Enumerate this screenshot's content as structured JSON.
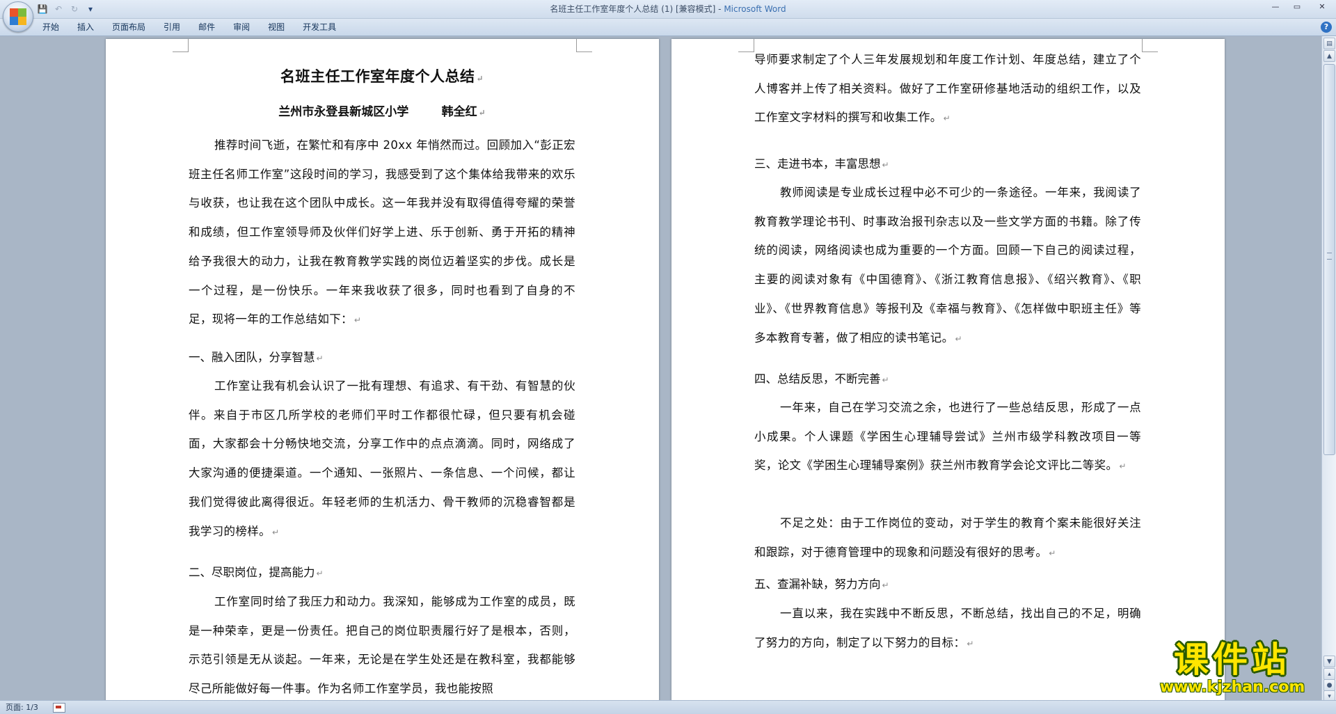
{
  "window": {
    "title": "名班主任工作室年度个人总结 (1) [兼容模式] - ",
    "app_name": "Microsoft Word",
    "minimize": "—",
    "maximize": "▭",
    "close": "✕"
  },
  "quick_access": {
    "save_icon": "💾",
    "undo_icon": "↶",
    "redo_icon": "↻",
    "customize_icon": "▾"
  },
  "ribbon": {
    "tabs": [
      "开始",
      "插入",
      "页面布局",
      "引用",
      "邮件",
      "审阅",
      "视图",
      "开发工具"
    ],
    "help": "?"
  },
  "left_page": {
    "title": "名班主任工作室年度个人总结",
    "author": "兰州市永登县新城区小学        韩全红",
    "p1": "推荐时间飞逝，在繁忙和有序中 20xx 年悄然而过。回顾加入“彭正宏班主任名师工作室”这段时间的学习，我感受到了这个集体给我带来的欢乐与收获，也让我在这个团队中成长。这一年我并没有取得值得夸耀的荣誉和成绩，但工作室领导师及伙伴们好学上进、乐于创新、勇于开拓的精神给予我很大的动力，让我在教育教学实践的岗位迈着坚实的步伐。成长是一个过程，是一份快乐。一年来我收获了很多，同时也看到了自身的不足，现将一年的工作总结如下：",
    "h1": "一、融入团队，分享智慧",
    "p2": "工作室让我有机会认识了一批有理想、有追求、有干劲、有智慧的伙伴。来自于市区几所学校的老师们平时工作都很忙碌，但只要有机会碰面，大家都会十分畅快地交流，分享工作中的点点滴滴。同时，网络成了大家沟通的便捷渠道。一个通知、一张照片、一条信息、一个问候，都让我们觉得彼此离得很近。年轻老师的生机活力、骨干教师的沉稳睿智都是我学习的榜样。",
    "h2": "二、尽职岗位，提高能力",
    "p3": "工作室同时给了我压力和动力。我深知，能够成为工作室的成员，既是一种荣幸，更是一份责任。把自己的岗位职责履行好了是根本，否则，示范引领是无从谈起。一年来，无论是在学生处还是在教科室，我都能够尽己所能做好每一件事。作为名师工作室学员，我也能按照"
  },
  "right_page": {
    "p0": "导师要求制定了个人三年发展规划和年度工作计划、年度总结，建立了个人博客并上传了相关资料。做好了工作室研修基地活动的组织工作，以及工作室文字材料的撰写和收集工作。",
    "h3": "三、走进书本，丰富思想",
    "p4": "教师阅读是专业成长过程中必不可少的一条途径。一年来，我阅读了教育教学理论书刊、时事政治报刊杂志以及一些文学方面的书籍。除了传统的阅读，网络阅读也成为重要的一个方面。回顾一下自己的阅读过程，主要的阅读对象有《中国德育》、《浙江教育信息报》、《绍兴教育》、《职业》、《世界教育信息》等报刊及《幸福与教育》、《怎样做中职班主任》等多本教育专著，做了相应的读书笔记。",
    "h4": "四、总结反思，不断完善",
    "p5": "一年来，自己在学习交流之余，也进行了一些总结反思，形成了一点小成果。个人课题《学困生心理辅导尝试》兰州市级学科教改项目一等奖，论文《学困生心理辅导案例》获兰州市教育学会论文评比二等奖。",
    "p6": "不足之处：由于工作岗位的变动，对于学生的教育个案未能很好关注和跟踪，对于德育管理中的现象和问题没有很好的思考。",
    "h5": "五、查漏补缺，努力方向",
    "p7": "一直以来，我在实践中不断反思，不断总结，找出自己的不足，明确了努力的方向，制定了以下努力的目标："
  },
  "paragraph_mark": "↵",
  "status": {
    "page": "页面: 1/3"
  },
  "watermark": {
    "main": "课件站",
    "url": "www.kjzhan.com"
  },
  "colors": {
    "workspace": "#a9b6c6",
    "accent": "#3a6fb0",
    "watermark_fill": "#ffe600",
    "watermark_outline": "#2a5a00"
  }
}
